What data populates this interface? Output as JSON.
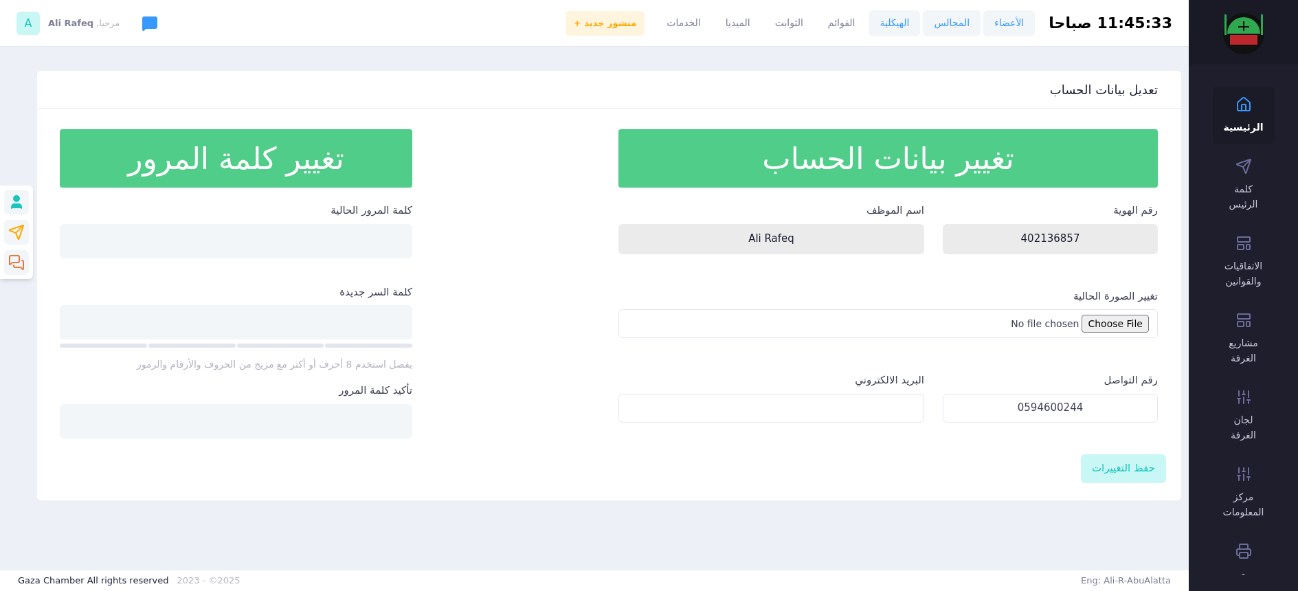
{
  "topbar": {
    "clock": "11:45:33 صباحا",
    "nav": [
      {
        "label": "الأعضاء",
        "selected": true
      },
      {
        "label": "المجالس",
        "selected": true
      },
      {
        "label": "الهيكلية",
        "selected": true
      },
      {
        "label": "القوائم",
        "selected": false
      },
      {
        "label": "الثوابت",
        "selected": false
      },
      {
        "label": "الميديا",
        "selected": false
      },
      {
        "label": "الخدمات",
        "selected": false
      }
    ],
    "new_post": "منشور جديد +",
    "greeting": "مرحبا,",
    "user_name": "Ali Rafeq",
    "avatar": "A"
  },
  "sidebar": {
    "items": [
      {
        "label": "الرئيسية",
        "kind": "home",
        "selected": true
      },
      {
        "label": "كلمة الرئيس",
        "kind": "send",
        "selected": false
      },
      {
        "label": "الاتفاقيات والقوانين",
        "kind": "panel",
        "selected": false
      },
      {
        "label": "مشاريع الغرفة",
        "kind": "panel",
        "selected": false
      },
      {
        "label": "لجان الغرفة",
        "kind": "sliders",
        "selected": false
      },
      {
        "label": "مركز المعلومات",
        "kind": "sliders",
        "selected": false
      },
      {
        "label": "-",
        "kind": "printer",
        "selected": false
      }
    ]
  },
  "quick_actions": [
    {
      "kind": "user",
      "color": "#1bc5bd"
    },
    {
      "kind": "send",
      "color": "#ffa800"
    },
    {
      "kind": "chat",
      "color": "#e4793f"
    }
  ],
  "card": {
    "title": "تعديل بيانات الحساب",
    "account": {
      "banner": "تغيير بيانات الحساب",
      "id_label": "رقم الهوية",
      "id_value": "402136857",
      "name_label": "اسم الموظف",
      "name_value": "Ali Rafeq",
      "photo_label": "تغيير الصورة الحالية",
      "file_button": "Choose File",
      "file_status": "No file chosen",
      "phone_label": "رقم التواصل",
      "phone_value": "0594600244",
      "email_label": "البريد الالكتروني",
      "save": "حفظ التغييرات"
    },
    "password": {
      "banner": "تغيير كلمة المرور",
      "current_label": "كلمة المرور الحالية",
      "new_label": "كلمة السر جديدة",
      "strength": {
        "level": 0
      },
      "hint": "يفضل استخدم 8 أحرف أو أكثر مع مزيج من الحروف والأرقام والرموز",
      "confirm_label": "تأكيد كلمة المرور"
    }
  },
  "footer": {
    "rights": "Gaza Chamber All rights reserved",
    "years": "2023 - ©2025",
    "credit": "Eng: Ali-R-AbuAlatta"
  }
}
